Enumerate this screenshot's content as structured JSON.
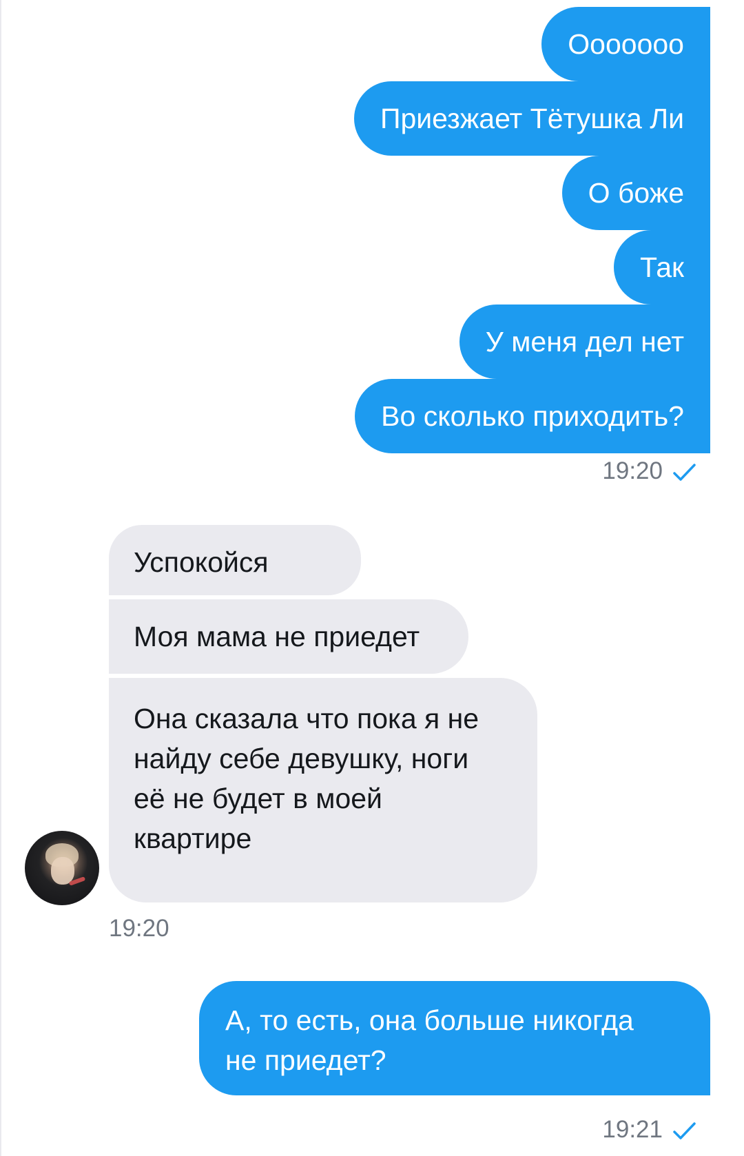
{
  "colors": {
    "outgoing_bubble": "#1d9bf0",
    "incoming_bubble": "#eaeaef",
    "timestamp": "#6f7680",
    "check": "#1d9bf0"
  },
  "messages_group_1": {
    "items": [
      {
        "text": "Ооооооо"
      },
      {
        "text": "Приезжает Тётушка Ли"
      },
      {
        "text": "О боже"
      },
      {
        "text": "Так"
      },
      {
        "text": "У меня дел нет"
      },
      {
        "text": "Во сколько приходить?"
      }
    ],
    "time": "19:20",
    "status_icon": "checkmark-icon"
  },
  "messages_group_2": {
    "items": [
      {
        "text": "Успокойся"
      },
      {
        "text": "Моя мама не приедет"
      },
      {
        "lines": [
          "Она сказала что пока я не",
          "найду себе девушку, ноги",
          "её не будет в моей",
          "квартире"
        ]
      }
    ],
    "time": "19:20",
    "avatar_icon": "user-avatar-icon"
  },
  "messages_group_3": {
    "items": [
      {
        "lines": [
          "А, то есть, она больше никогда",
          "не приедет?"
        ]
      }
    ],
    "time": "19:21",
    "status_icon": "checkmark-icon"
  }
}
